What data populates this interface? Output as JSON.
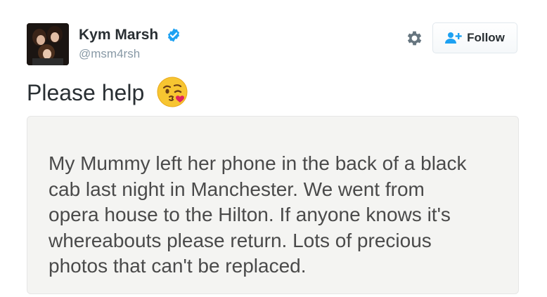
{
  "user": {
    "display_name": "Kym Marsh",
    "handle": "@msm4rsh",
    "verified": true
  },
  "actions": {
    "settings_icon": "gear-icon",
    "follow_label": "Follow"
  },
  "tweet": {
    "text": "Please help",
    "emoji": "face-throwing-a-kiss"
  },
  "image_note": {
    "text": "My Mummy left her phone in the back of a black\ncab last night in Manchester. We went from\nopera house to the Hilton. If anyone knows it's\nwhereabouts please return. Lots of precious\nphotos that can't be replaced."
  },
  "colors": {
    "verified_blue": "#1da1f2",
    "follow_icon_blue": "#1da1f2",
    "name_text": "#292f33",
    "handle_text": "#8899a6"
  }
}
